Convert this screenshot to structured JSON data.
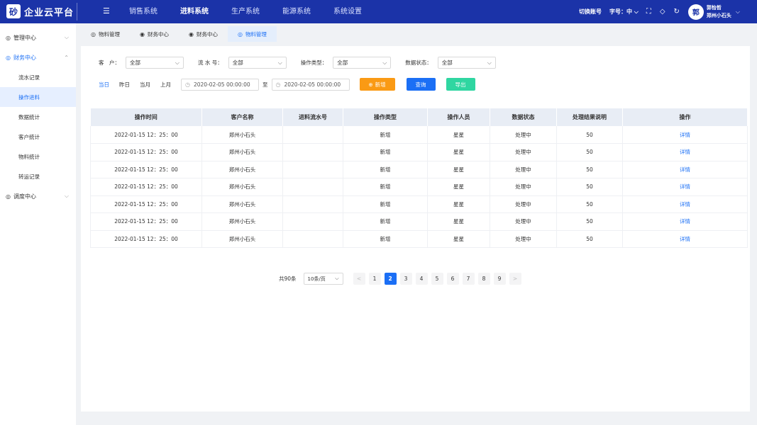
{
  "brand": {
    "logo": "砂",
    "name": "企业云平台"
  },
  "top_nav": [
    "销售系统",
    "进料系统",
    "生产系统",
    "能源系统",
    "系统设置"
  ],
  "top_nav_active": 1,
  "top_right": {
    "switch_account": "切换账号",
    "font_size": "字号：中"
  },
  "user": {
    "avatar": "郭",
    "name": "郭怡哲",
    "org": "郑州小石头"
  },
  "sidebar": {
    "groups": [
      {
        "label": "管理中心",
        "icon": "◎",
        "caret": "⌵"
      },
      {
        "label": "财务中心",
        "icon": "◎",
        "caret": "⌃"
      },
      {
        "label": "调度中心",
        "icon": "◎",
        "caret": "⌵"
      }
    ],
    "items": [
      "流水记录",
      "操作进料",
      "数据统计",
      "客户统计",
      "物料统计",
      "转运记录"
    ]
  },
  "tabs": [
    "物料管理",
    "财务中心",
    "财务中心",
    "物料管理"
  ],
  "filters": {
    "customer_label": "客　户：",
    "customer_value": "全部",
    "serial_label": "流 水 号：",
    "serial_value": "全部",
    "optype_label": "操作类型：",
    "optype_value": "全部",
    "status_label": "数据状态：",
    "status_value": "全部"
  },
  "quick_dates": [
    "当日",
    "昨日",
    "当月",
    "上月"
  ],
  "date_range": {
    "start": "2020-02-05  00:00:00",
    "separator": "至",
    "end": "2020-02-05  00:00:00"
  },
  "buttons": {
    "add": "新增",
    "query": "查询",
    "export": "导出"
  },
  "colors": {
    "add": "#fa9a14",
    "query": "#1b6ff5",
    "export": "#2fd6a1",
    "accent": "#1b6ff5",
    "topbar": "#1b33a8"
  },
  "table": {
    "headers": [
      "操作时间",
      "客户名称",
      "进料流水号",
      "操作类型",
      "操作人员",
      "数据状态",
      "处理结果说明",
      "操作"
    ],
    "rows": [
      [
        "2022-01-15  12：25：00",
        "郑州小石头",
        "",
        "新增",
        "星星",
        "处理中",
        "50",
        "详情"
      ],
      [
        "2022-01-15  12：25：00",
        "郑州小石头",
        "",
        "新增",
        "星星",
        "处理中",
        "50",
        "详情"
      ],
      [
        "2022-01-15  12：25：00",
        "郑州小石头",
        "",
        "新增",
        "星星",
        "处理中",
        "50",
        "详情"
      ],
      [
        "2022-01-15  12：25：00",
        "郑州小石头",
        "",
        "新增",
        "星星",
        "处理中",
        "50",
        "详情"
      ],
      [
        "2022-01-15  12：25：00",
        "郑州小石头",
        "",
        "新增",
        "星星",
        "处理中",
        "50",
        "详情"
      ],
      [
        "2022-01-15  12：25：00",
        "郑州小石头",
        "",
        "新增",
        "星星",
        "处理中",
        "50",
        "详情"
      ],
      [
        "2022-01-15  12：25：00",
        "郑州小石头",
        "",
        "新增",
        "星星",
        "处理中",
        "50",
        "详情"
      ]
    ]
  },
  "pagination": {
    "total": "共90条",
    "page_size": "10条/页",
    "prev": "<",
    "next": ">",
    "pages": [
      "1",
      "2",
      "3",
      "4",
      "5",
      "6",
      "7",
      "8",
      "9"
    ],
    "current": "2"
  }
}
